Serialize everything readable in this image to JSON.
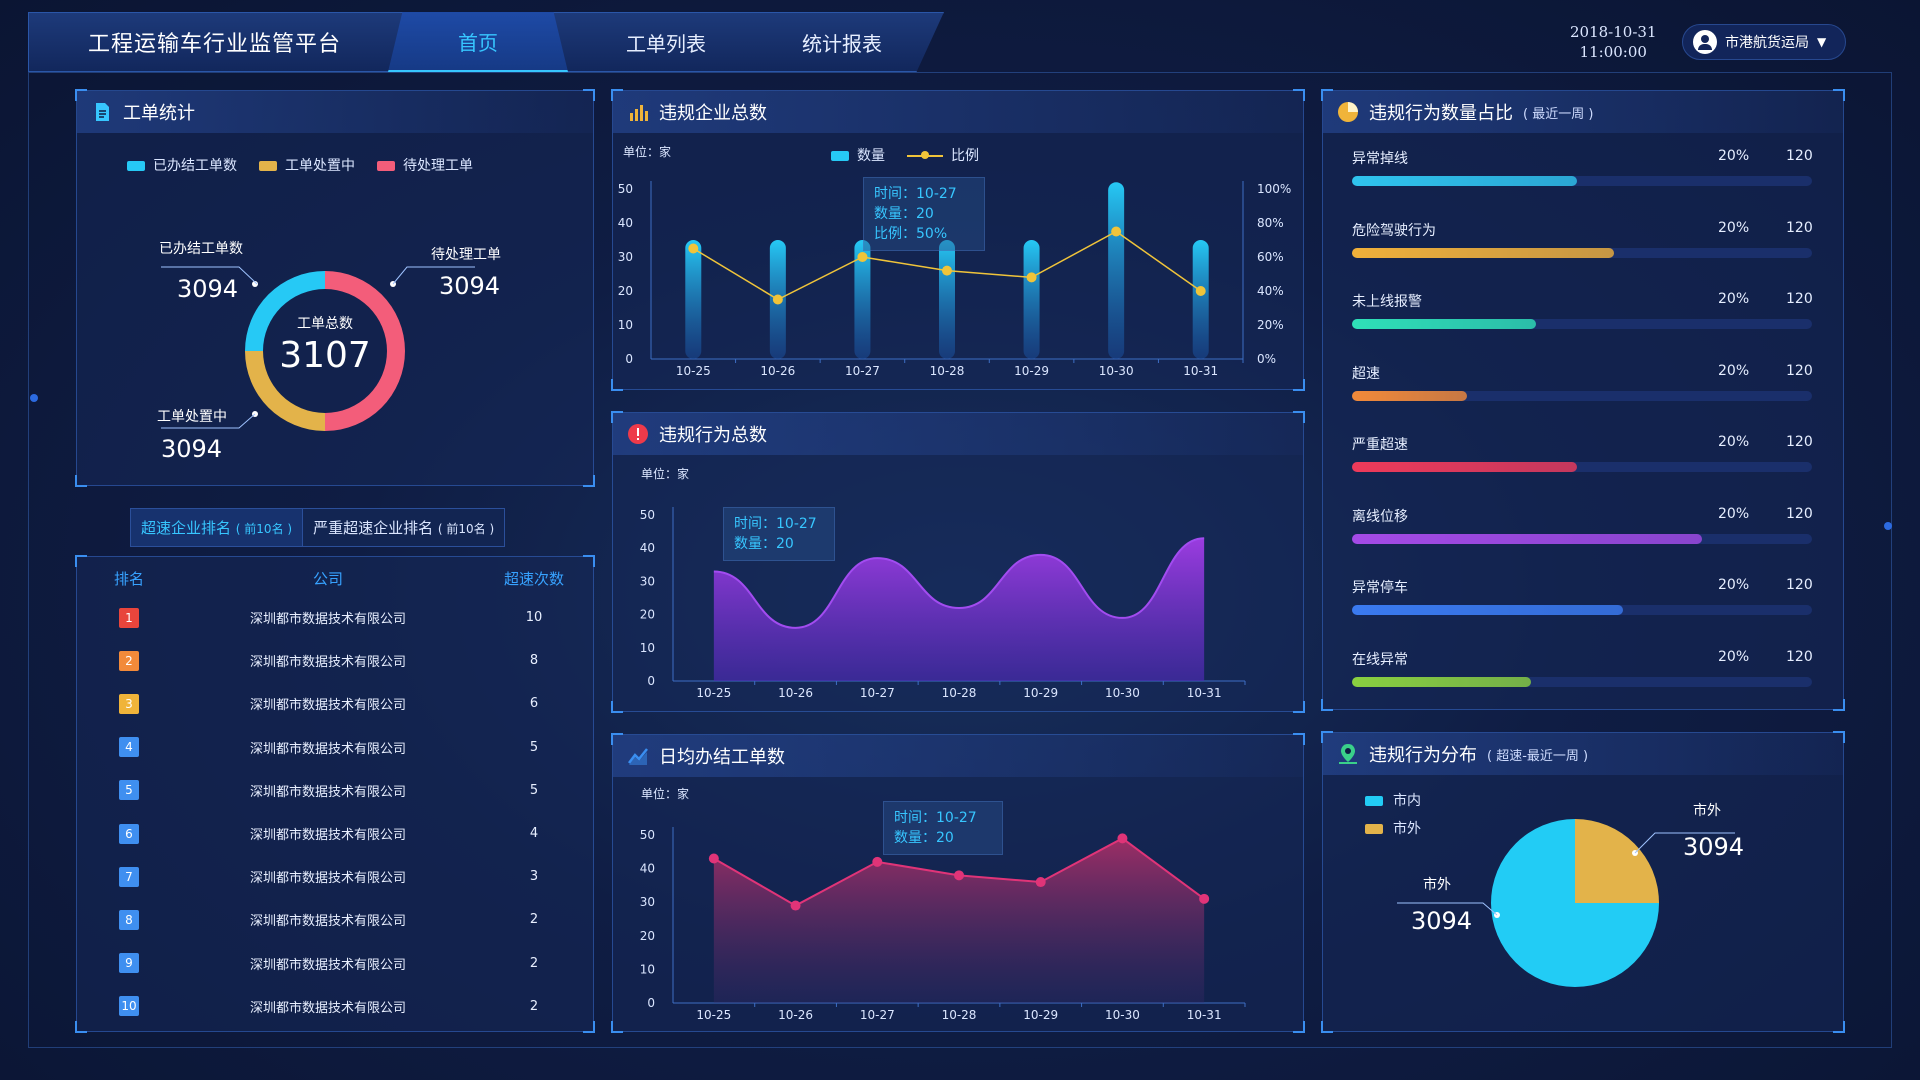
{
  "header": {
    "app_title": "工程运输车行业监管平台",
    "tabs": [
      {
        "label": "首页",
        "active": true
      },
      {
        "label": "工单列表",
        "active": false
      },
      {
        "label": "统计报表",
        "active": false
      }
    ],
    "date": "2018-10-31",
    "time": "11:00:00",
    "user": "市港航货运局"
  },
  "workorder_panel": {
    "title": "工单统计",
    "legend": [
      "已办结工单数",
      "工单处置中",
      "待处理工单"
    ],
    "center_label": "工单总数",
    "center_value": "3107",
    "labels": [
      {
        "name": "已办结工单数",
        "value": "3094"
      },
      {
        "name": "待处理工单",
        "value": "3094"
      },
      {
        "name": "工单处置中",
        "value": "3094"
      }
    ]
  },
  "ranking": {
    "tabs": [
      {
        "label": "超速企业排名",
        "suffix": "( 前10名 )",
        "active": true
      },
      {
        "label": "严重超速企业排名",
        "suffix": "( 前10名 )",
        "active": false
      }
    ],
    "headers": [
      "排名",
      "公司",
      "超速次数"
    ],
    "rows": [
      {
        "rank": "1",
        "company": "深圳都市数据技术有限公司",
        "count": "10",
        "color": "#e8453c"
      },
      {
        "rank": "2",
        "company": "深圳都市数据技术有限公司",
        "count": "8",
        "color": "#f28a3a"
      },
      {
        "rank": "3",
        "company": "深圳都市数据技术有限公司",
        "count": "6",
        "color": "#f0b43a"
      },
      {
        "rank": "4",
        "company": "深圳都市数据技术有限公司",
        "count": "5",
        "color": "#3f8ff0"
      },
      {
        "rank": "5",
        "company": "深圳都市数据技术有限公司",
        "count": "5",
        "color": "#3f8ff0"
      },
      {
        "rank": "6",
        "company": "深圳都市数据技术有限公司",
        "count": "4",
        "color": "#3f8ff0"
      },
      {
        "rank": "7",
        "company": "深圳都市数据技术有限公司",
        "count": "3",
        "color": "#3f8ff0"
      },
      {
        "rank": "8",
        "company": "深圳都市数据技术有限公司",
        "count": "2",
        "color": "#3f8ff0"
      },
      {
        "rank": "9",
        "company": "深圳都市数据技术有限公司",
        "count": "2",
        "color": "#3f8ff0"
      },
      {
        "rank": "10",
        "company": "深圳都市数据技术有限公司",
        "count": "2",
        "color": "#3f8ff0"
      }
    ]
  },
  "enterprise_panel": {
    "title": "违规企业总数",
    "unit": "单位：家",
    "legend": [
      "数量",
      "比例"
    ],
    "tooltip": [
      "时间：10-27",
      "数量：20",
      "比例：50%"
    ]
  },
  "behavior_panel": {
    "title": "违规行为总数",
    "unit": "单位：家",
    "tooltip": [
      "时间：10-27",
      "数量：20"
    ]
  },
  "daily_panel": {
    "title": "日均办结工单数",
    "unit": "单位：家",
    "tooltip": [
      "时间：10-27",
      "数量：20"
    ]
  },
  "ratio_panel": {
    "title": "违规行为数量占比",
    "subtitle": "( 最近一周 )",
    "items": [
      {
        "label": "异常掉线",
        "pct": "20%",
        "count": "120",
        "fill": 0.49,
        "color": "#2fc4ee"
      },
      {
        "label": "危险驾驶行为",
        "pct": "20%",
        "count": "120",
        "fill": 0.57,
        "color": "#f0b03a"
      },
      {
        "label": "未上线报警",
        "pct": "20%",
        "count": "120",
        "fill": 0.4,
        "color": "#2fe0b8"
      },
      {
        "label": "超速",
        "pct": "20%",
        "count": "120",
        "fill": 0.25,
        "color": "#f28a3a"
      },
      {
        "label": "严重超速",
        "pct": "20%",
        "count": "120",
        "fill": 0.49,
        "color": "#ee3a5a"
      },
      {
        "label": "离线位移",
        "pct": "20%",
        "count": "120",
        "fill": 0.76,
        "color": "#a44ae6"
      },
      {
        "label": "异常停车",
        "pct": "20%",
        "count": "120",
        "fill": 0.59,
        "color": "#3a7af0"
      },
      {
        "label": "在线异常",
        "pct": "20%",
        "count": "120",
        "fill": 0.39,
        "color": "#8ad040"
      }
    ]
  },
  "distribution_panel": {
    "title": "违规行为分布",
    "subtitle": "( 超速-最近一周 )",
    "legend": [
      "市内",
      "市外"
    ],
    "labels": [
      {
        "name": "市外",
        "value": "3094"
      },
      {
        "name": "市外",
        "value": "3094"
      }
    ]
  },
  "chart_data": [
    {
      "type": "pie",
      "title": "工单统计",
      "categories": [
        "已办结工单数",
        "工单处置中",
        "待处理工单"
      ],
      "values": [
        25,
        25,
        50
      ],
      "colors": [
        "#26c9f5",
        "#e3b34a",
        "#f35d7a"
      ]
    },
    {
      "type": "bar",
      "title": "违规企业总数",
      "categories": [
        "10-25",
        "10-26",
        "10-27",
        "10-28",
        "10-29",
        "10-30",
        "10-31"
      ],
      "series": [
        {
          "name": "数量",
          "values": [
            35,
            35,
            35,
            35,
            35,
            52,
            35
          ],
          "type": "bar"
        },
        {
          "name": "比例",
          "values": [
            65,
            35,
            60,
            52,
            48,
            75,
            40
          ],
          "type": "line",
          "axis": "right"
        }
      ],
      "ylim": [
        0,
        50
      ],
      "yticks": [
        0,
        10,
        20,
        30,
        40,
        50
      ],
      "y2lim": [
        0,
        100
      ],
      "y2ticks": [
        "0%",
        "20%",
        "40%",
        "60%",
        "80%",
        "100%"
      ]
    },
    {
      "type": "area",
      "title": "违规行为总数",
      "categories": [
        "10-25",
        "10-26",
        "10-27",
        "10-28",
        "10-29",
        "10-30",
        "10-31"
      ],
      "values": [
        33,
        16,
        37,
        22,
        38,
        19,
        43
      ],
      "ylim": [
        0,
        50
      ],
      "yticks": [
        0,
        10,
        20,
        30,
        40,
        50
      ]
    },
    {
      "type": "area",
      "title": "日均办结工单数",
      "categories": [
        "10-25",
        "10-26",
        "10-27",
        "10-28",
        "10-29",
        "10-30",
        "10-31"
      ],
      "values": [
        43,
        29,
        42,
        38,
        36,
        49,
        31
      ],
      "ylim": [
        0,
        50
      ],
      "yticks": [
        0,
        10,
        20,
        30,
        40,
        50
      ]
    },
    {
      "type": "pie",
      "title": "违规行为分布",
      "categories": [
        "市内",
        "市外"
      ],
      "values": [
        75,
        25
      ],
      "colors": [
        "#22ccf5",
        "#e3b34a"
      ]
    }
  ]
}
